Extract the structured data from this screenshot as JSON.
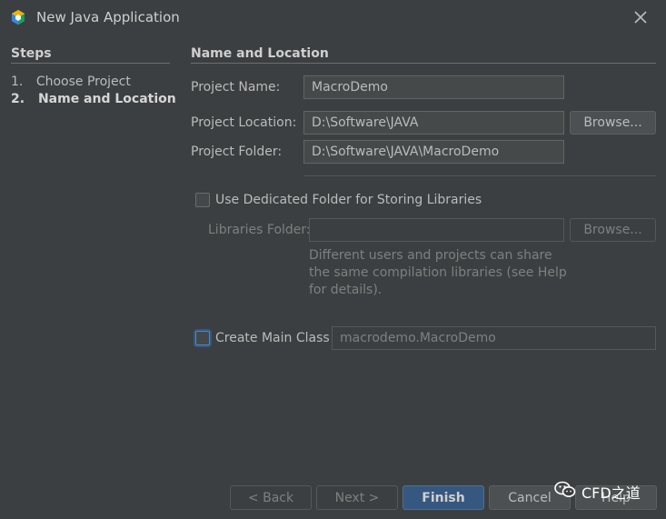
{
  "window": {
    "title": "New Java Application"
  },
  "sidebar": {
    "title": "Steps",
    "steps": [
      {
        "num": "1.",
        "label": "Choose Project"
      },
      {
        "num": "2.",
        "label": "Name and Location"
      }
    ]
  },
  "main": {
    "section_title": "Name and Location",
    "project_name": {
      "label": "Project Name:",
      "value": "MacroDemo"
    },
    "project_location": {
      "label": "Project Location:",
      "value": "D:\\Software\\JAVA",
      "browse": "Browse..."
    },
    "project_folder": {
      "label": "Project Folder:",
      "value": "D:\\Software\\JAVA\\MacroDemo"
    },
    "dedicated_folder": {
      "label": "Use Dedicated Folder for Storing Libraries"
    },
    "libraries_folder": {
      "label": "Libraries Folder:",
      "value": "",
      "browse": "Browse..."
    },
    "hint_lines": [
      "Different users and projects can share",
      "the same compilation libraries (see Help",
      "for details)."
    ],
    "create_main_class": {
      "label": "Create Main Class",
      "value": "macrodemo.MacroDemo"
    }
  },
  "footer": {
    "back": "< Back",
    "next": "Next >",
    "finish": "Finish",
    "cancel": "Cancel",
    "help": "Help"
  },
  "watermark": {
    "text": "CFD之道"
  },
  "colors": {
    "accent": "#365880",
    "background": "#3c3f41",
    "focus": "#4a88c7"
  }
}
